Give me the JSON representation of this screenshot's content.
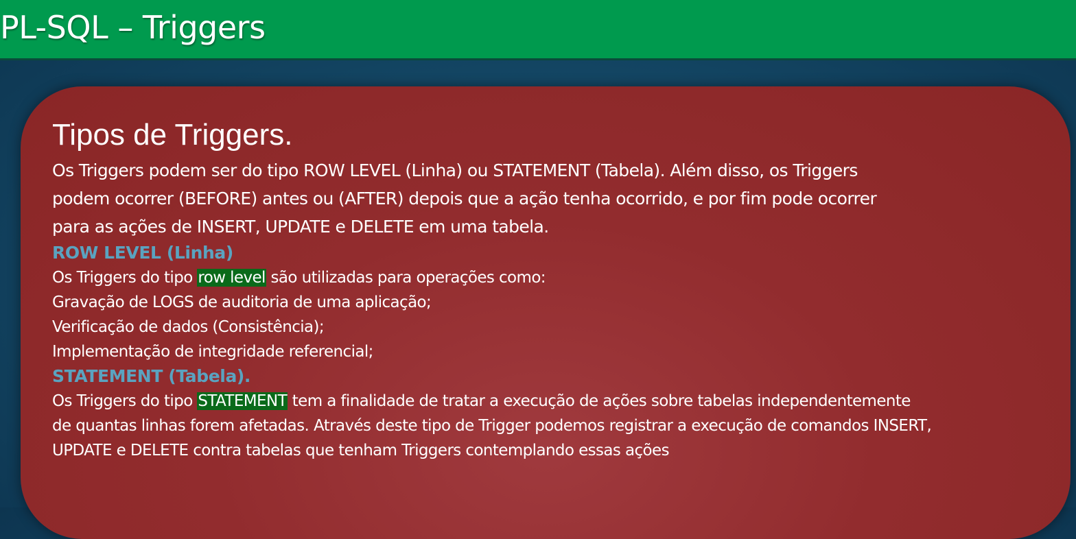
{
  "header": {
    "title": "PL-SQL – Triggers"
  },
  "section": {
    "title": "Tipos de Triggers.",
    "intro": [
      "Os Triggers podem ser do tipo ROW LEVEL (Linha) ou STATEMENT (Tabela). Além disso, os Triggers",
      "podem ocorrer (BEFORE) antes ou (AFTER) depois que a ação tenha ocorrido, e por fim pode ocorrer",
      "para as ações de INSERT, UPDATE e DELETE em uma tabela."
    ]
  },
  "row_level": {
    "heading": "ROW LEVEL (Linha)",
    "lead_before": "Os Triggers do tipo ",
    "lead_highlight": "row level",
    "lead_after": " são utilizadas para operações como:",
    "items": [
      "Gravação de LOGS de auditoria de uma aplicação;",
      "Verificação de dados (Consistência);",
      "Implementação de integridade referencial;"
    ]
  },
  "statement": {
    "heading": "STATEMENT (Tabela).",
    "line1_before": "Os Triggers do tipo ",
    "line1_highlight": "STATEMENT",
    "line1_after": " tem a finalidade de tratar a execução de ações sobre tabelas independentemente",
    "line2": "de quantas linhas forem afetadas. Através deste tipo de Trigger podemos registrar a execução de comandos INSERT,",
    "line3": "UPDATE e DELETE contra tabelas que tenham Triggers contemplando essas ações"
  },
  "colors": {
    "header_bg": "#009a4e",
    "card_bg": "#922c2e",
    "subheading": "#5aa3c0",
    "highlight": "#0a6a1a"
  }
}
